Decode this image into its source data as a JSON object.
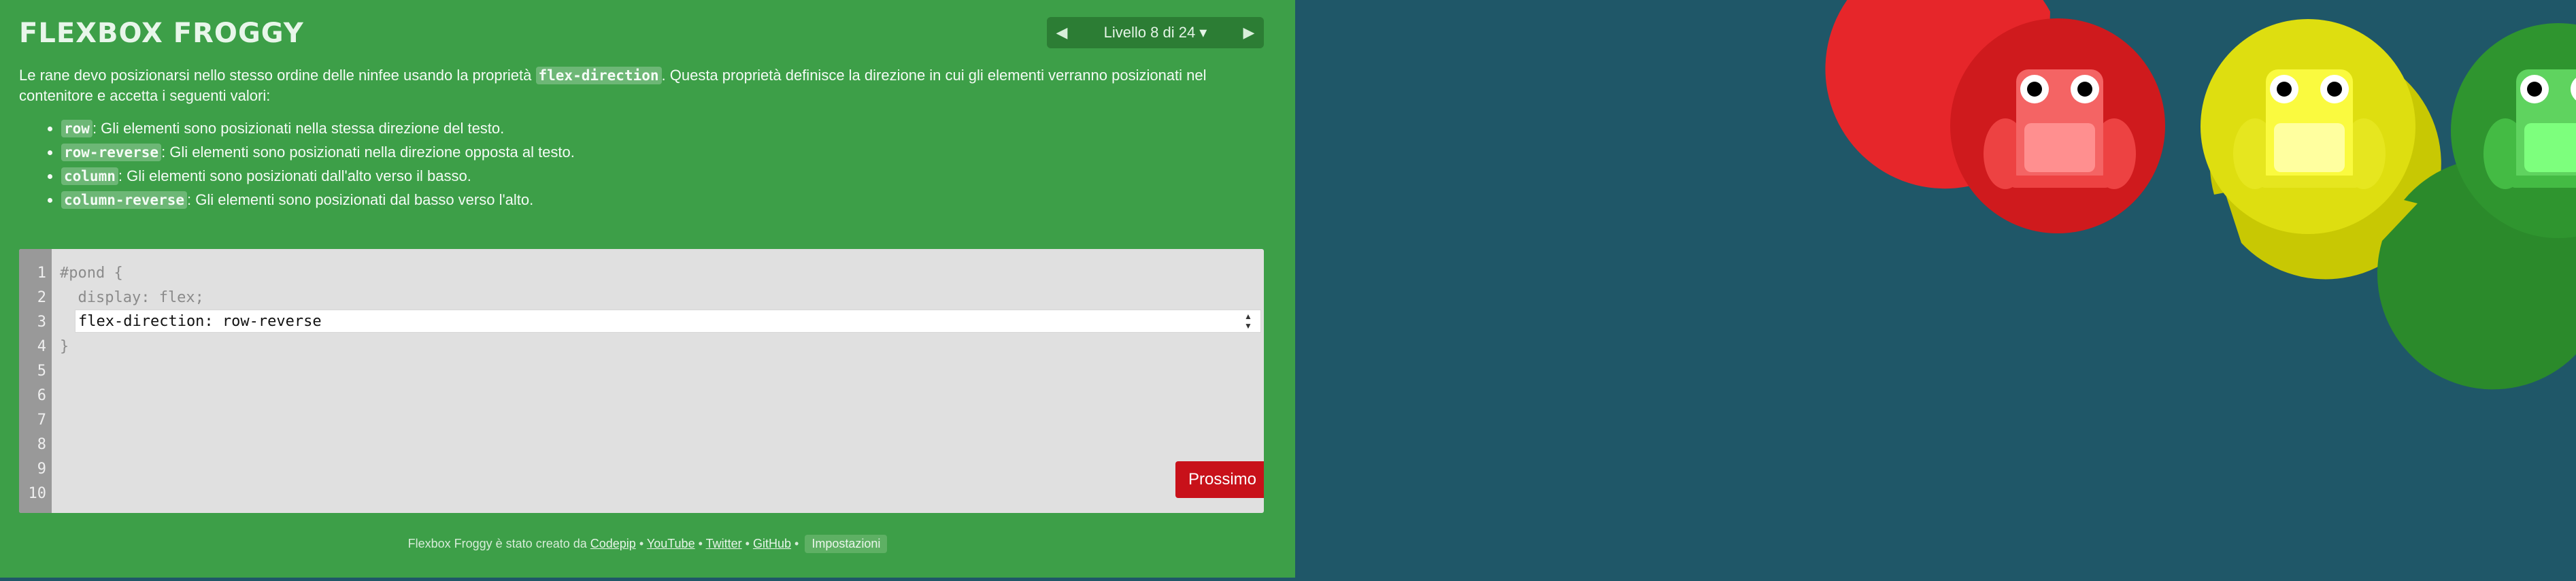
{
  "app": {
    "title": "FLEXBOX FROGGY"
  },
  "level_nav": {
    "level_label": "Livello 8 di 24 ▾"
  },
  "instructions": {
    "intro_before": "Le rane devo posizionarsi nello stesso ordine delle ninfee usando la proprietà ",
    "intro_code": "flex-direction",
    "intro_after": ". Questa proprietà definisce la direzione in cui gli elementi verranno posizionati nel contenitore e accetta i seguenti valori:",
    "values": [
      {
        "code": "row",
        "desc": ": Gli elementi sono posizionati nella stessa direzione del testo."
      },
      {
        "code": "row-reverse",
        "desc": ": Gli elementi sono posizionati nella direzione opposta al testo."
      },
      {
        "code": "column",
        "desc": ": Gli elementi sono posizionati dall'alto verso il basso."
      },
      {
        "code": "column-reverse",
        "desc": ": Gli elementi sono posizionati dal basso verso l'alto."
      }
    ]
  },
  "editor": {
    "line_numbers": [
      "1",
      "2",
      "3",
      "4",
      "5",
      "6",
      "7",
      "8",
      "9",
      "10"
    ],
    "lines": [
      "#pond {",
      "  display: flex;",
      "",
      "}"
    ],
    "input_value": "flex-direction: row-reverse",
    "next_label": "Prossimo"
  },
  "footer": {
    "credit": "Flexbox Froggy è stato creato da",
    "codepip": "Codepip",
    "youtube": "YouTube",
    "twitter": "Twitter",
    "github": "GitHub",
    "separator": "•",
    "settings": "Impostazioni"
  },
  "pond": {
    "background": "#1f5768",
    "frogs": [
      {
        "color": "red",
        "pad": "#e6262a",
        "body": "#f46464",
        "belly": "#ff8f8f"
      },
      {
        "color": "yellow",
        "pad": "#c8c803",
        "body": "#fafa3f",
        "belly": "#ffff9f"
      },
      {
        "color": "green",
        "pad": "#2b8a2b",
        "body": "#5fd35f",
        "belly": "#7dff7d"
      }
    ]
  }
}
